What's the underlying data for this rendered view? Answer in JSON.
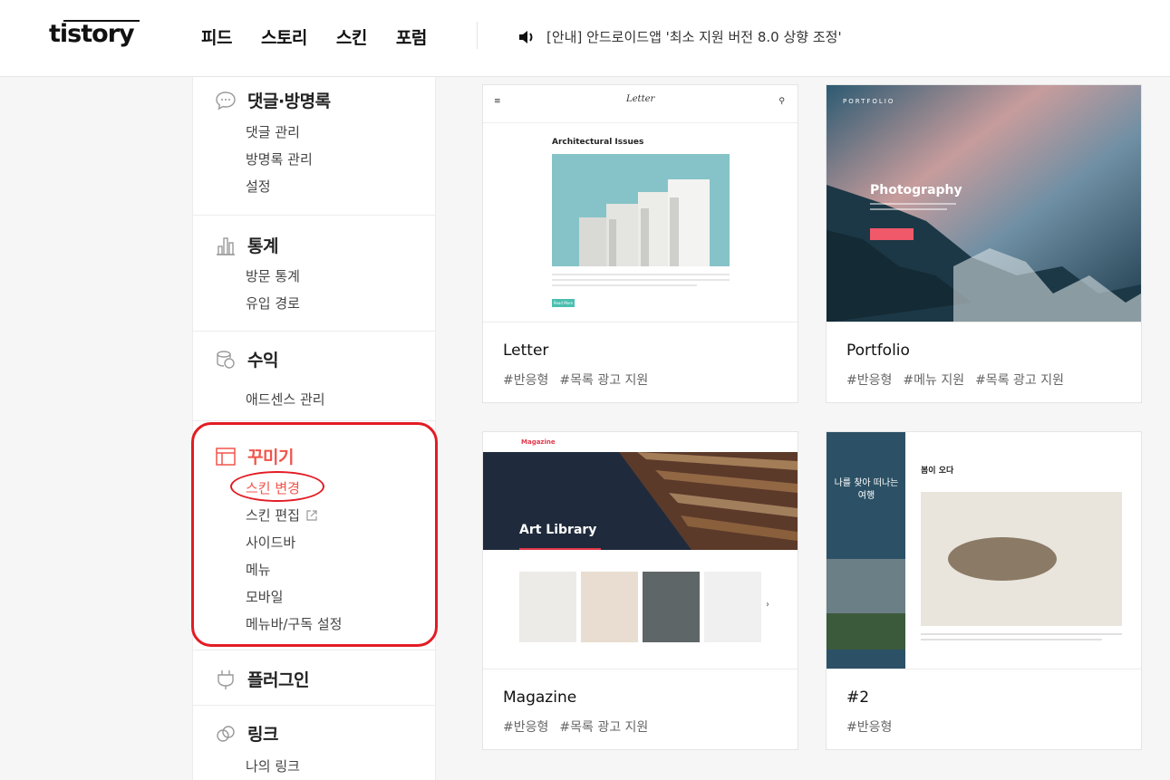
{
  "header": {
    "logo": "tistory",
    "nav": [
      "피드",
      "스토리",
      "스킨",
      "포럼"
    ],
    "notice": "[안내] 안드로이드앱 '최소 지원 버전 8.0 상향 조정'"
  },
  "sidebar": {
    "sections": [
      {
        "title": "댓글·방명록",
        "icon": "speech-bubble-icon",
        "items": [
          "댓글 관리",
          "방명록 관리",
          "설정"
        ]
      },
      {
        "title": "통계",
        "icon": "bar-chart-icon",
        "items": [
          "방문 통계",
          "유입 경로"
        ]
      },
      {
        "title": "수익",
        "icon": "coins-icon",
        "items": [
          "애드센스 관리"
        ]
      },
      {
        "title": "꾸미기",
        "icon": "layout-icon",
        "items": [
          "스킨 변경",
          "스킨 편집",
          "사이드바",
          "메뉴",
          "모바일",
          "메뉴바/구독 설정"
        ]
      },
      {
        "title": "플러그인",
        "icon": "plug-icon",
        "items": []
      },
      {
        "title": "링크",
        "icon": "link-icon",
        "items": [
          "나의 링크"
        ]
      }
    ]
  },
  "skins": [
    {
      "name": "Letter",
      "tags": [
        "#반응형",
        "#목록 광고 지원"
      ],
      "preview_title": "Letter",
      "preview_heading": "Architectural Issues",
      "preview_button": "Read More"
    },
    {
      "name": "Portfolio",
      "tags": [
        "#반응형",
        "#메뉴 지원",
        "#목록 광고 지원"
      ],
      "preview_brand": "PORTFOLIO",
      "preview_heading": "Photography"
    },
    {
      "name": "Magazine",
      "tags": [
        "#반응형",
        "#목록 광고 지원"
      ],
      "preview_brand": "Magazine",
      "preview_heading": "Art Library"
    },
    {
      "name": "#2",
      "tags": [
        "#반응형"
      ],
      "preview_side": "나를 찾아 떠나는 여행",
      "preview_heading": "봄이 오다"
    }
  ],
  "colors": {
    "accent": "#f0554b",
    "annotation": "#e21c24"
  }
}
